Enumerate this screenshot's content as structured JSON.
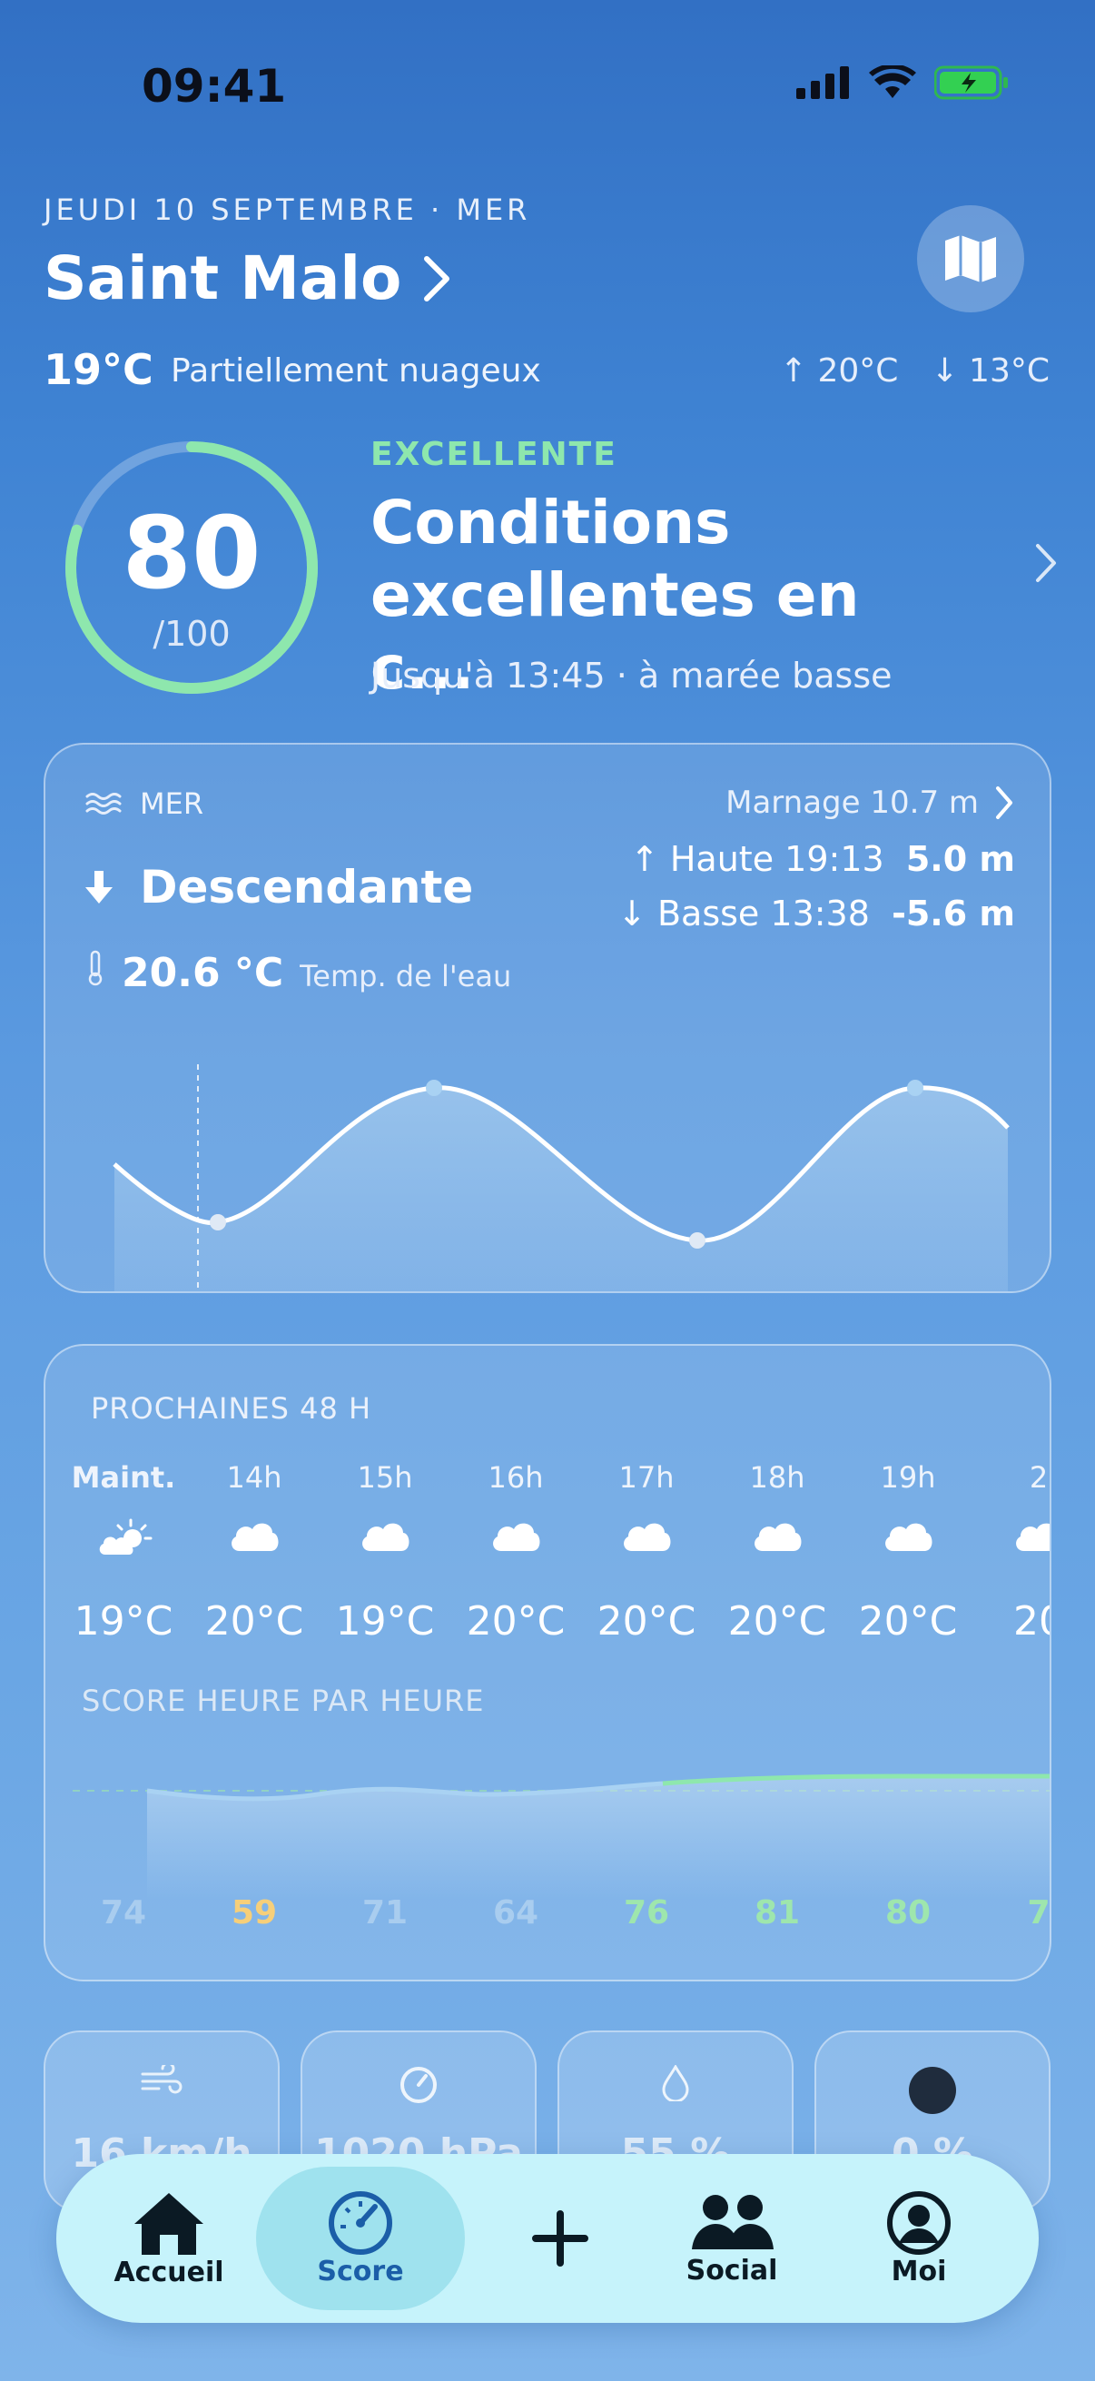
{
  "status": {
    "time": "09:41"
  },
  "header": {
    "date": "JEUDI 10 SEPTEMBRE · MER",
    "city": "Saint Malo",
    "temp_now": "19°C",
    "condition": "Partiellement nuageux",
    "high": "↑ 20°C",
    "low": "↓ 13°C"
  },
  "score": {
    "value": "80",
    "max": "/100",
    "progress": 0.8,
    "level": "EXCELLENTE",
    "title": "Conditions excellentes en c...",
    "subtitle": "Jusqu'à 13:45 · à marée basse"
  },
  "sea": {
    "label": "MER",
    "marnage": "Marnage 10.7 m",
    "trend": "Descendante",
    "high_label": "↑ Haute 19:13",
    "high_value": "5.0 m",
    "low_label": "↓ Basse 13:38",
    "low_value": "-5.6 m",
    "water_temp": "20.6 °C",
    "water_label": "Temp. de l'eau"
  },
  "forecast": {
    "label": "PROCHAINES 48 H",
    "hours": [
      {
        "h": "Maint.",
        "t": "19°C",
        "icon": "sun-cloud-icon"
      },
      {
        "h": "14h",
        "t": "20°C",
        "icon": "cloud-icon"
      },
      {
        "h": "15h",
        "t": "19°C",
        "icon": "cloud-icon"
      },
      {
        "h": "16h",
        "t": "20°C",
        "icon": "cloud-icon"
      },
      {
        "h": "17h",
        "t": "20°C",
        "icon": "cloud-icon"
      },
      {
        "h": "18h",
        "t": "20°C",
        "icon": "cloud-icon"
      },
      {
        "h": "19h",
        "t": "20°C",
        "icon": "cloud-icon"
      },
      {
        "h": "2",
        "t": "20",
        "icon": "cloud-icon"
      }
    ],
    "score_label": "SCORE HEURE PAR HEURE",
    "scores": [
      {
        "v": "74",
        "color": "#a9cdef"
      },
      {
        "v": "59",
        "color": "#f6cf7a"
      },
      {
        "v": "71",
        "color": "#a9cdef"
      },
      {
        "v": "64",
        "color": "#a9cdef"
      },
      {
        "v": "76",
        "color": "#9ee6ad"
      },
      {
        "v": "81",
        "color": "#9ee6ad"
      },
      {
        "v": "80",
        "color": "#9ee6ad"
      },
      {
        "v": "7",
        "color": "#9ee6ad"
      }
    ]
  },
  "mini": [
    {
      "v": "16 km/h",
      "icon": "wind-icon"
    },
    {
      "v": "1020 hPa",
      "icon": "gauge-icon"
    },
    {
      "v": "55 %",
      "icon": "humidity-icon"
    },
    {
      "v": "0 %",
      "icon": "moon-icon"
    }
  ],
  "nav": {
    "home": "Accueil",
    "score": "Score",
    "social": "Social",
    "me": "Moi"
  },
  "colors": {
    "accent_green": "#8ee7ad",
    "nav_bg": "#c6f3fb"
  }
}
